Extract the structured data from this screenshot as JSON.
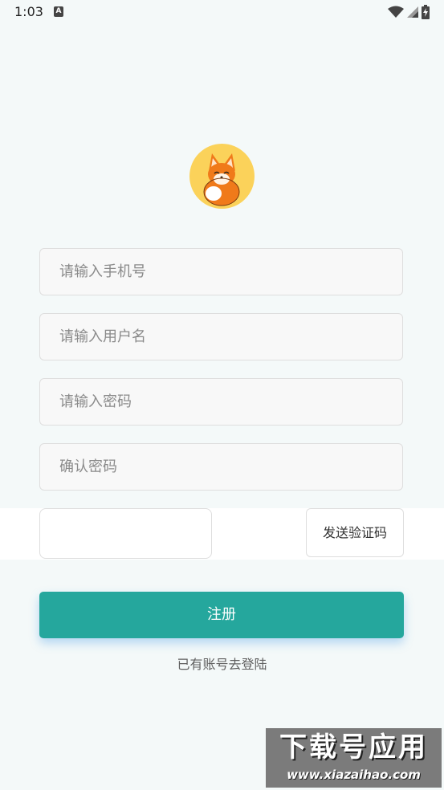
{
  "status_bar": {
    "time": "1:03",
    "notification_icon": "text-a-icon",
    "icons": [
      "wifi-icon",
      "signal-icon",
      "battery-charging-icon"
    ]
  },
  "logo": {
    "icon": "fox-mascot-icon",
    "bg_color": "#fbd25a"
  },
  "form": {
    "phone_placeholder": "请输入手机号",
    "username_placeholder": "请输入用户名",
    "password_placeholder": "请输入密码",
    "confirm_placeholder": "确认密码",
    "code_value": "",
    "send_code_label": "发送验证码",
    "register_label": "注册",
    "login_link": "已有账号去登陆"
  },
  "colors": {
    "accent": "#25a79d",
    "background": "#f4f9f9"
  },
  "watermark": {
    "title": "下载号应用",
    "url": "www.xiazaihao.com"
  }
}
